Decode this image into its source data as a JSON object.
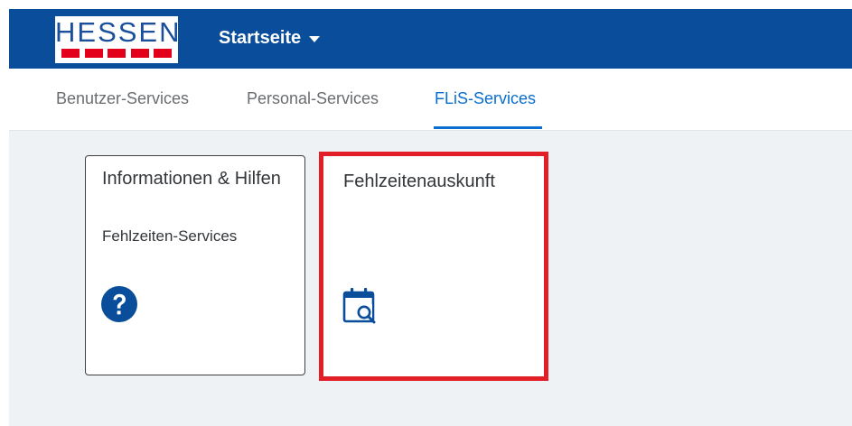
{
  "shell": {
    "logo_text": "HESSEN",
    "app_title": "Startseite",
    "colors": {
      "header": "#0a4e9b",
      "logo_red": "#e2001a",
      "accent": "#0a6ed1",
      "highlight": "#e21f26"
    }
  },
  "tabs": [
    {
      "label": "Benutzer-Services",
      "selected": false
    },
    {
      "label": "Personal-Services",
      "selected": false
    },
    {
      "label": "FLiS-Services",
      "selected": true
    }
  ],
  "tiles": [
    {
      "title": "Informationen & Hilfen",
      "subtitle": "Fehlzeiten-Services",
      "icon": "help-icon"
    },
    {
      "title": "Fehlzeitenauskunft",
      "subtitle": "",
      "icon": "calendar-search-icon",
      "highlighted": true
    }
  ]
}
